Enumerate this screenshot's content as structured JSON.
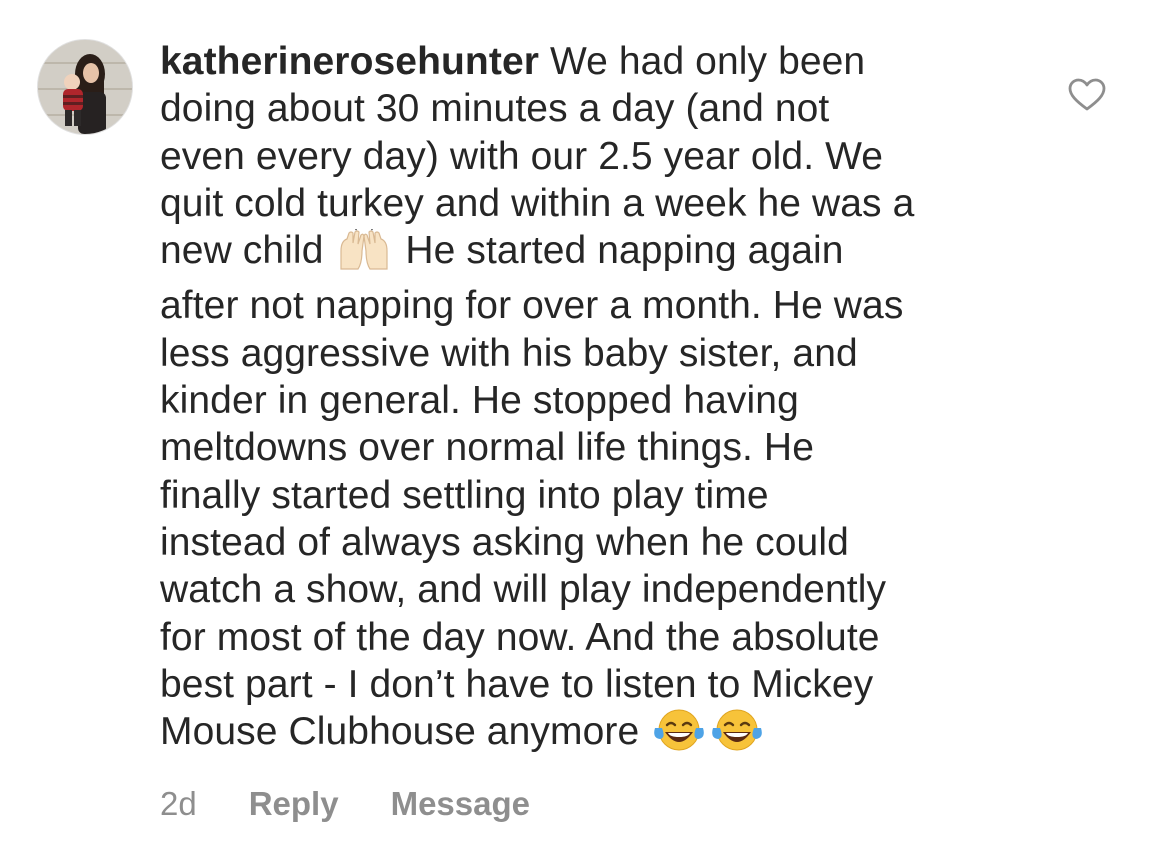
{
  "comment": {
    "username": "katherinerosehunter",
    "lines": [
      " We had only been",
      "doing about 30 minutes a day (and not",
      "even every day) with our 2.5 year old. We",
      "quit cold turkey and within a week he was a",
      "new child ",
      " He started napping again",
      "after not napping for over a month. He was",
      "less aggressive with his baby sister, and",
      "kinder in general. He stopped having",
      "meltdowns over normal life things. He",
      "finally started settling into play time",
      "instead of always asking when he could",
      "watch a show, and will play independently",
      "for most of the day now. And the absolute",
      "best part - I don’t have to listen to Mickey",
      "Mouse Clubhouse anymore "
    ],
    "emoji": {
      "raised_hands": "raising-hands-emoji",
      "laughing_1": "tears-of-joy-emoji",
      "laughing_2": "tears-of-joy-emoji"
    }
  },
  "meta": {
    "time": "2d",
    "reply_label": "Reply",
    "message_label": "Message"
  },
  "icons": {
    "like": "heart-outline-icon"
  },
  "colors": {
    "text": "#262626",
    "secondary": "#8e8e8e",
    "background": "#ffffff"
  }
}
